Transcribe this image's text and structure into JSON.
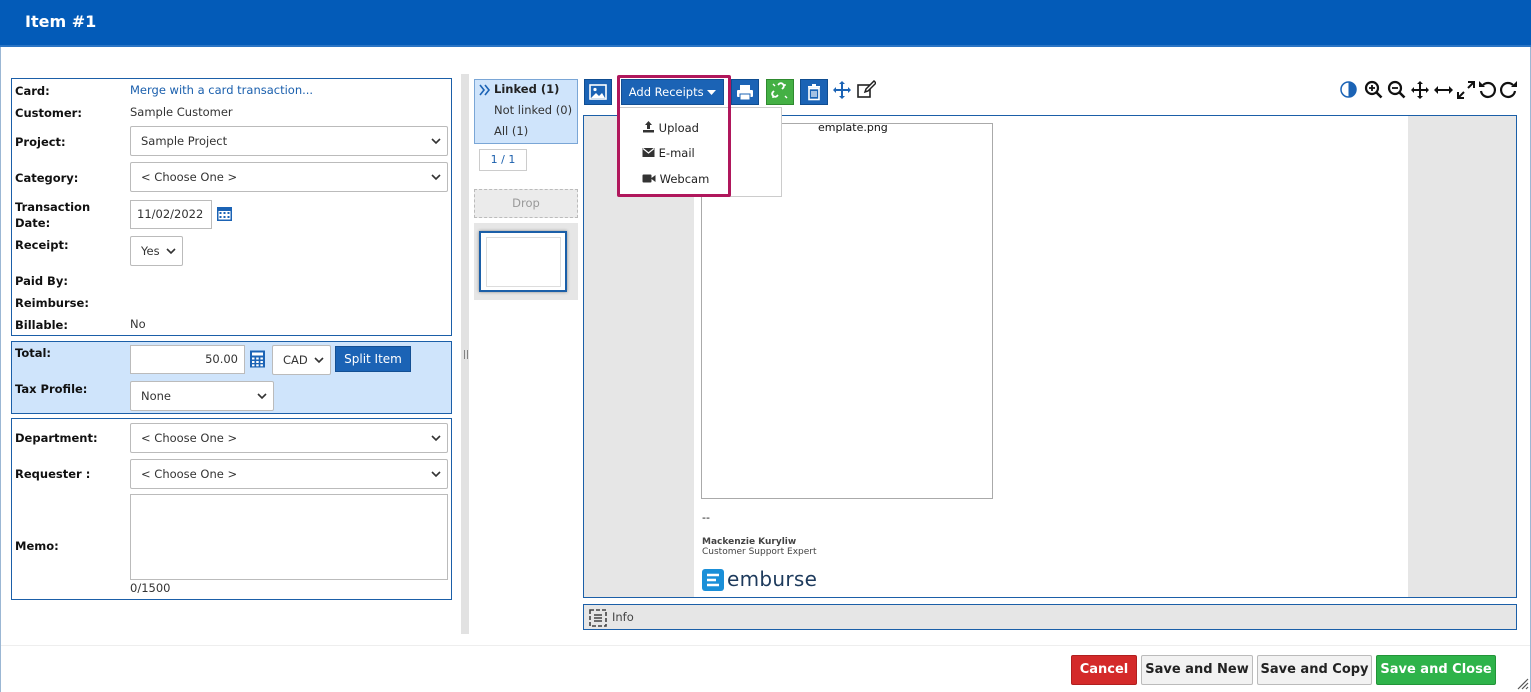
{
  "window": {
    "title": "Item #1"
  },
  "form": {
    "card_label": "Card:",
    "card_value": "Merge with a card transaction...",
    "customer_label": "Customer:",
    "customer_value": "Sample Customer",
    "project_label": "Project:",
    "project_value": "Sample Project",
    "category_label": "Category:",
    "category_value": "< Choose One >",
    "transaction_label_1": "Transaction",
    "transaction_label_2": "Date:",
    "transaction_date": "11/02/2022",
    "receipt_label": "Receipt:",
    "receipt_value": "Yes",
    "paid_by_label": "Paid By:",
    "reimburse_label": "Reimburse:",
    "billable_label": "Billable:",
    "billable_value": "No",
    "total_label": "Total:",
    "total_value": "50.00",
    "currency": "CAD",
    "split_label": "Split Item",
    "tax_label": "Tax Profile:",
    "tax_value": "None",
    "department_label": "Department:",
    "department_value": "< Choose One >",
    "requester_label": "Requester :",
    "requester_value": "< Choose One >",
    "memo_label": "Memo:",
    "memo_count": "0/1500"
  },
  "receipts": {
    "linked": "Linked (1)",
    "not_linked": "Not linked (0)",
    "all": "All (1)",
    "pager": "1 / 1",
    "drop": "Drop"
  },
  "toolbar": {
    "add_receipts": "Add Receipts",
    "menu": [
      "Upload",
      "E-mail",
      "Webcam"
    ]
  },
  "viewer": {
    "filename": "emplate.png",
    "dash": "--",
    "sig_name": "Mackenzie Kuryliw",
    "sig_title": "Customer Support Expert",
    "logo_text": "emburse",
    "info_label": "Info"
  },
  "footer": {
    "cancel": "Cancel",
    "save_new": "Save and New",
    "save_copy": "Save and Copy",
    "save_close": "Save and Close"
  },
  "colors": {
    "header": "#035bb8",
    "cancel": "#d42a2a",
    "save_close": "#2eb34a",
    "highlight": "#b0175c"
  }
}
